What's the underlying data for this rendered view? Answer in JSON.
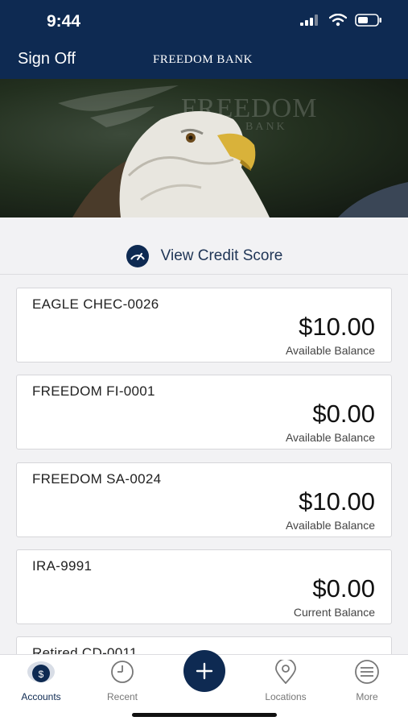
{
  "status_bar": {
    "time": "9:44"
  },
  "nav": {
    "sign_off": "Sign Off",
    "title": "FREEDOM BANK"
  },
  "banner": {
    "watermark": "FREEDOM",
    "watermark_sub": "BANK"
  },
  "credit": {
    "label": "View Credit Score"
  },
  "accounts": [
    {
      "name": "EAGLE CHEC-0026",
      "amount": "$10.00",
      "balance_label": "Available Balance"
    },
    {
      "name": "FREEDOM FI-0001",
      "amount": "$0.00",
      "balance_label": "Available Balance"
    },
    {
      "name": "FREEDOM SA-0024",
      "amount": "$10.00",
      "balance_label": "Available Balance"
    },
    {
      "name": "IRA-9991",
      "amount": "$0.00",
      "balance_label": "Current Balance"
    },
    {
      "name": "Retired CD-0011"
    }
  ],
  "tabs": {
    "accounts": "Accounts",
    "recent": "Recent",
    "locations": "Locations",
    "more": "More"
  },
  "colors": {
    "brand_navy": "#0e2a52",
    "background": "#f2f2f4"
  }
}
